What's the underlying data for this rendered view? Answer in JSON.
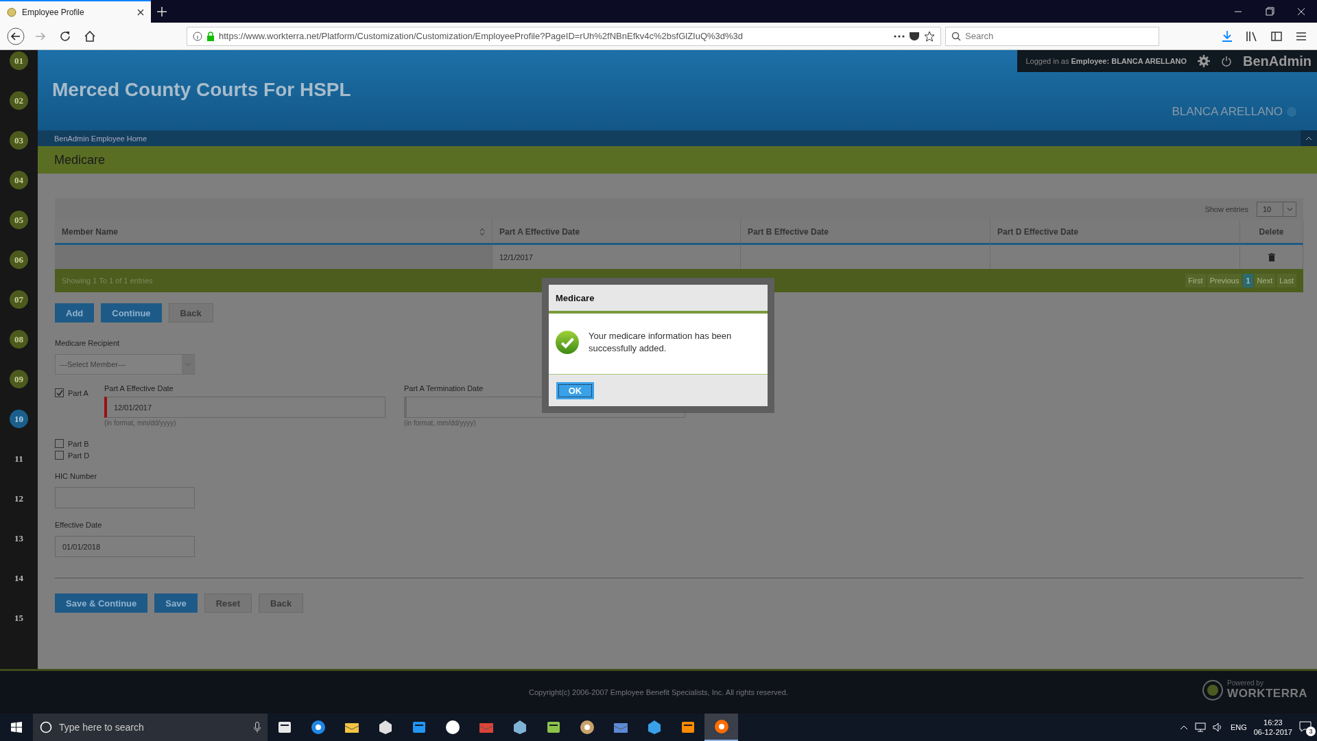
{
  "browser": {
    "tab_title": "Employee Profile",
    "url": "https://www.workterra.net/Platform/Customization/Customization/EmployeeProfile?PageID=rUh%2fNBnEfkv4c%2bsfGlZIuQ%3d%3d",
    "search_placeholder": "Search"
  },
  "steps": [
    {
      "label": "01",
      "completed": true,
      "selected": false
    },
    {
      "label": "02",
      "completed": true,
      "selected": false
    },
    {
      "label": "03",
      "completed": true,
      "selected": false
    },
    {
      "label": "04",
      "completed": true,
      "selected": false
    },
    {
      "label": "05",
      "completed": true,
      "selected": false
    },
    {
      "label": "06",
      "completed": true,
      "selected": false
    },
    {
      "label": "07",
      "completed": true,
      "selected": false
    },
    {
      "label": "08",
      "completed": true,
      "selected": false
    },
    {
      "label": "09",
      "completed": true,
      "selected": false
    },
    {
      "label": "10",
      "completed": false,
      "selected": true
    },
    {
      "label": "11",
      "completed": false,
      "selected": false
    },
    {
      "label": "12",
      "completed": false,
      "selected": false
    },
    {
      "label": "13",
      "completed": false,
      "selected": false
    },
    {
      "label": "14",
      "completed": false,
      "selected": false
    },
    {
      "label": "15",
      "completed": false,
      "selected": false
    }
  ],
  "header": {
    "title": "Merced County Courts For HSPL",
    "logged_in": "Logged in as **Employee:  BLANCA ARELLANO**",
    "app_name": "BenAdmin",
    "user_name": "BLANCA ARELLANO"
  },
  "breadcrumb": "BenAdmin Employee Home",
  "section_title": "Medicare",
  "table": {
    "show_entries_label": "Show entries",
    "page_size": "10",
    "columns": [
      "Member Name",
      "Part A Effective Date",
      "Part B Effective Date",
      "Part D Effective Date",
      "Delete"
    ],
    "rows": [
      [
        "",
        "12/1/2017",
        "",
        ""
      ]
    ],
    "summary": "Showing 1 To 1 of 1 entries",
    "pager": [
      {
        "label": "First",
        "selected": false
      },
      {
        "label": "Previous",
        "selected": false
      },
      {
        "label": "1",
        "selected": true
      },
      {
        "label": "Next",
        "selected": false
      },
      {
        "label": "Last",
        "selected": false
      }
    ]
  },
  "actions": [
    "Add",
    "Continue",
    "Back"
  ],
  "form": {
    "recipient_label": "Medicare Recipient",
    "recipient_placeholder": "---Select Member---",
    "parts": [
      {
        "label": "Part A",
        "checked": true
      },
      {
        "label": "Part B",
        "checked": false
      },
      {
        "label": "Part D",
        "checked": false
      }
    ],
    "part_a_effective_label": "Part A Effective Date",
    "part_a_effective_value": "12/01/2017",
    "part_a_effective_hint": "(in format, mm/dd/yyyy)",
    "part_a_termination_label": "Part A Termination Date",
    "part_a_termination_hint": "(in format, mm/dd/yyyy)",
    "hic_label": "HIC Number",
    "effective_label": "Effective Date",
    "effective_value": "01/01/2018"
  },
  "bottom_actions": [
    "Save & Continue",
    "Save",
    "Reset",
    "Back"
  ],
  "footer": {
    "copyright": "Copyright(c) 2006-2007 Employee Benefit Specialists, Inc. All rights reserved.",
    "powered_by": "Powered by",
    "brand": "WORKTERRA"
  },
  "dialog": {
    "title": "Medicare",
    "message": "Your medicare information has been successfully added.",
    "ok": "OK"
  },
  "taskbar": {
    "search_placeholder": "Type here to search",
    "language": "ENG",
    "time": "16:23",
    "date": "06-12-2017",
    "notifications": "3"
  }
}
